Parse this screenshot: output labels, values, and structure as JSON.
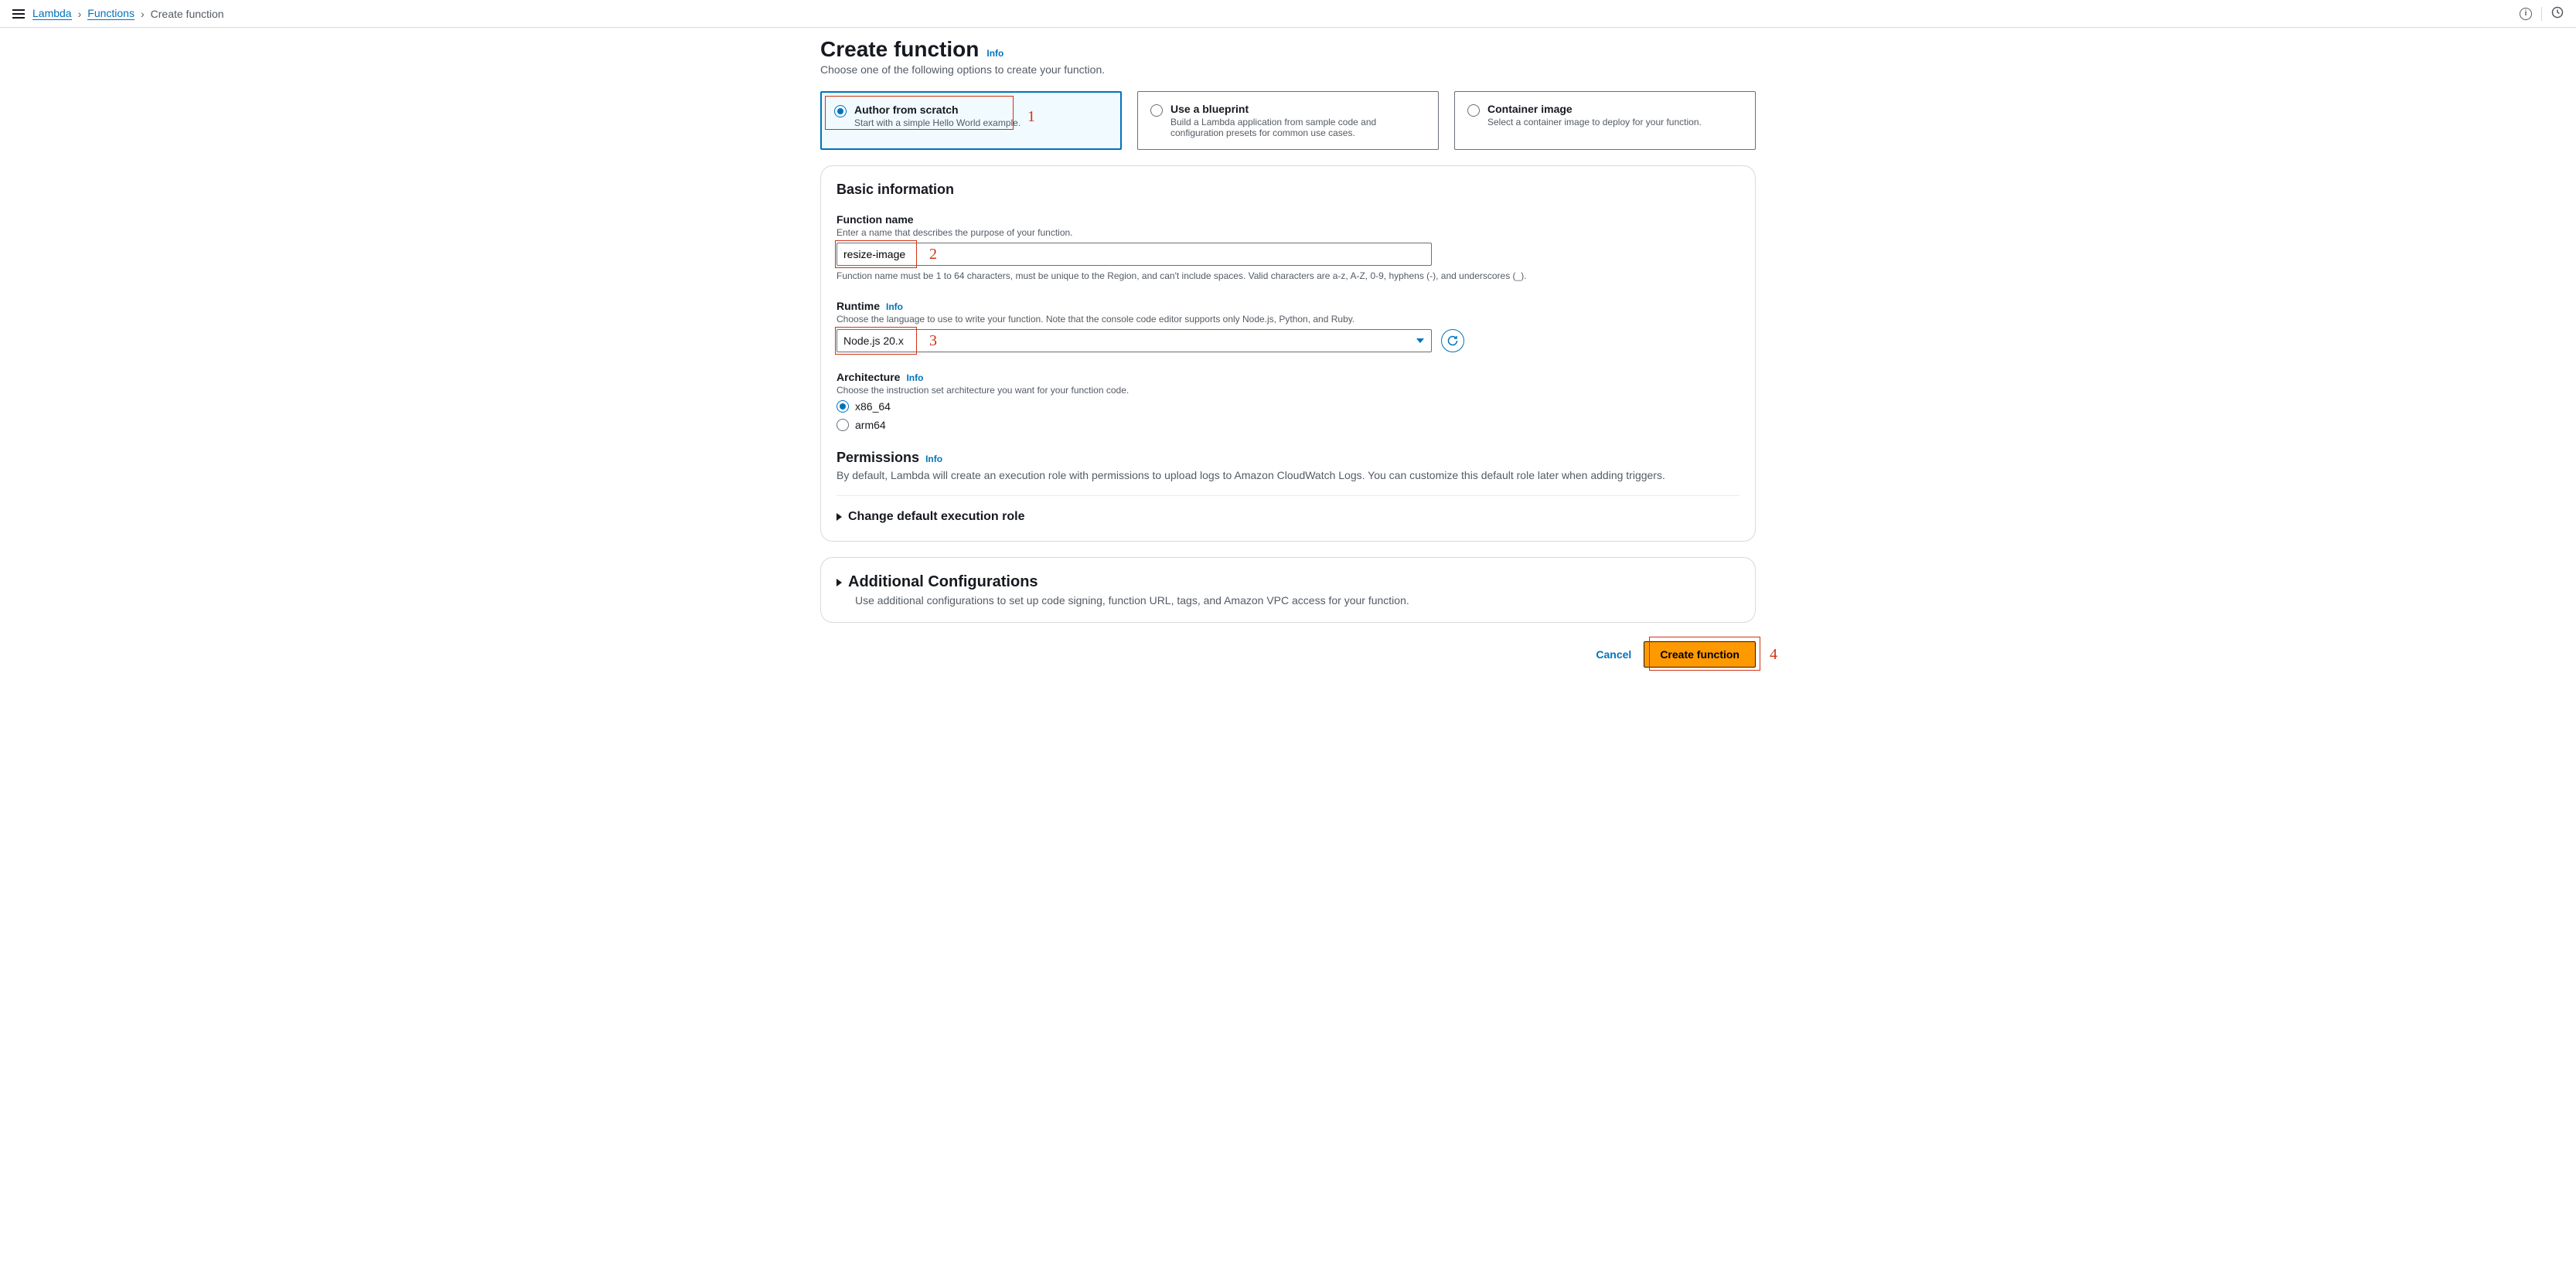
{
  "breadcrumb": {
    "root": "Lambda",
    "mid": "Functions",
    "current": "Create function"
  },
  "page": {
    "title": "Create function",
    "info_link": "Info",
    "subtitle": "Choose one of the following options to create your function."
  },
  "options": {
    "author": {
      "title": "Author from scratch",
      "desc": "Start with a simple Hello World example."
    },
    "blueprint": {
      "title": "Use a blueprint",
      "desc": "Build a Lambda application from sample code and configuration presets for common use cases."
    },
    "container": {
      "title": "Container image",
      "desc": "Select a container image to deploy for your function."
    }
  },
  "basic": {
    "heading": "Basic information",
    "function_name": {
      "label": "Function name",
      "help": "Enter a name that describes the purpose of your function.",
      "value": "resize-image",
      "constraint": "Function name must be 1 to 64 characters, must be unique to the Region, and can't include spaces. Valid characters are a-z, A-Z, 0-9, hyphens (-), and underscores (_)."
    },
    "runtime": {
      "label": "Runtime",
      "info_link": "Info",
      "help": "Choose the language to use to write your function. Note that the console code editor supports only Node.js, Python, and Ruby.",
      "value": "Node.js 20.x"
    },
    "architecture": {
      "label": "Architecture",
      "info_link": "Info",
      "help": "Choose the instruction set architecture you want for your function code.",
      "opt1": "x86_64",
      "opt2": "arm64"
    },
    "permissions": {
      "heading": "Permissions",
      "info_link": "Info",
      "desc": "By default, Lambda will create an execution role with permissions to upload logs to Amazon CloudWatch Logs. You can customize this default role later when adding triggers."
    },
    "expander": "Change default execution role"
  },
  "additional": {
    "heading": "Additional Configurations",
    "desc": "Use additional configurations to set up code signing, function URL, tags, and Amazon VPC access for your function."
  },
  "footer": {
    "cancel": "Cancel",
    "create": "Create function"
  },
  "annotations": {
    "n1": "1",
    "n2": "2",
    "n3": "3",
    "n4": "4"
  }
}
